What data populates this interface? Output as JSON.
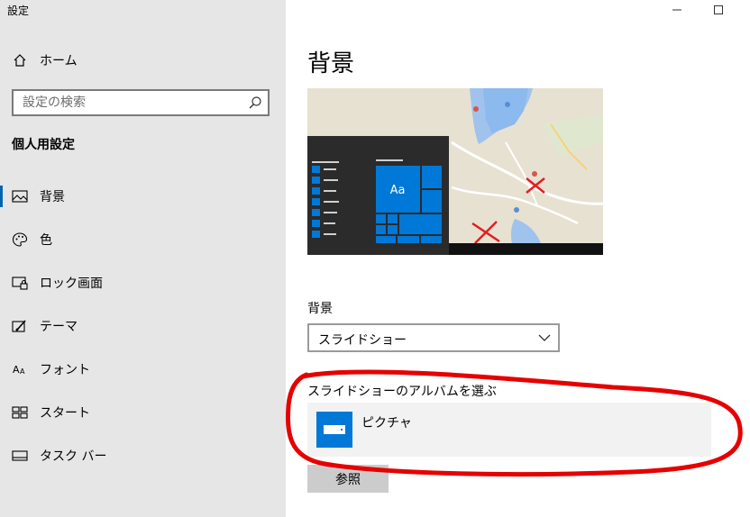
{
  "app_title": "設定",
  "window_controls": {
    "minimize_icon": "minimize-icon",
    "maximize_icon": "maximize-icon"
  },
  "sidebar": {
    "home_label": "ホーム",
    "search_placeholder": "設定の検索",
    "section_title": "個人用設定",
    "items": [
      {
        "label": "背景",
        "icon": "image-icon",
        "active": true
      },
      {
        "label": "色",
        "icon": "palette-icon"
      },
      {
        "label": "ロック画面",
        "icon": "lock-screen-icon"
      },
      {
        "label": "テーマ",
        "icon": "theme-brush-icon"
      },
      {
        "label": "フォント",
        "icon": "font-icon"
      },
      {
        "label": "スタート",
        "icon": "start-grid-icon"
      },
      {
        "label": "タスク バー",
        "icon": "taskbar-icon"
      }
    ]
  },
  "main": {
    "title": "背景",
    "preview": {
      "tile_text": "Aa"
    },
    "background_label": "背景",
    "background_value": "スライドショー",
    "album_label": "スライドショーのアルバムを選ぶ",
    "album_name": "ピクチャ",
    "browse_label": "参照"
  },
  "colors": {
    "accent": "#0078d7",
    "annotation": "#e60000"
  }
}
